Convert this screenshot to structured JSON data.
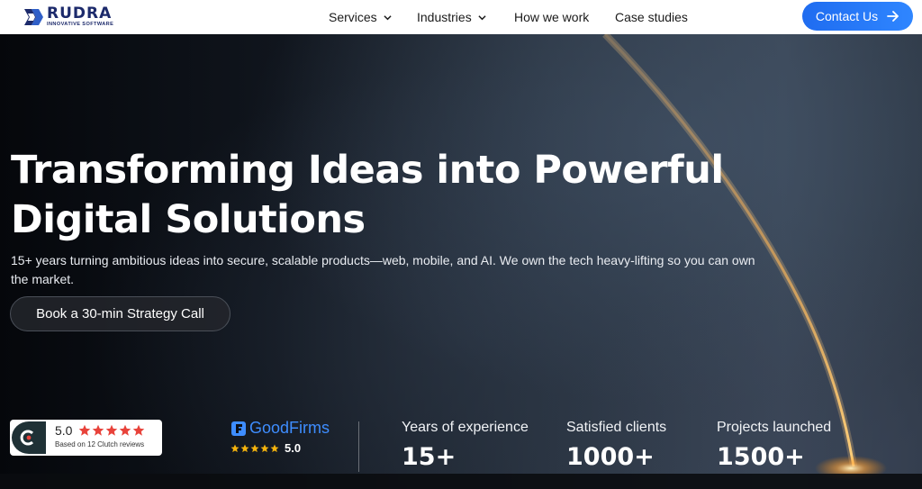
{
  "header": {
    "brand_name": "RUDRA",
    "brand_tagline": "INNOVATIVE SOFTWARE",
    "nav": [
      {
        "label": "Services",
        "has_dropdown": true
      },
      {
        "label": "Industries",
        "has_dropdown": true
      },
      {
        "label": "How we work",
        "has_dropdown": false
      },
      {
        "label": "Case studies",
        "has_dropdown": false
      }
    ],
    "contact_label": "Contact Us",
    "contact_icon": "arrow-right-icon"
  },
  "hero": {
    "headline": "Transforming Ideas into Powerful Digital Solutions",
    "subheadline": "15+ years turning ambitious ideas into secure, scalable products—web, mobile, and AI. We own the tech heavy-lifting so you can own the market.",
    "cta_label": "Book a 30-min Strategy Call"
  },
  "clutch": {
    "score": "5.0",
    "stars": 5,
    "caption": "Based on 12 Clutch reviews",
    "logo_icon": "clutch-logo-icon"
  },
  "goodfirms": {
    "brand": "GoodFirms",
    "stars": 5,
    "score": "5.0"
  },
  "stats": [
    {
      "label": "Years of experience",
      "value": "15+"
    },
    {
      "label": "Satisfied clients",
      "value": "1000+"
    },
    {
      "label": "Projects launched",
      "value": "1500+"
    }
  ],
  "colors": {
    "accent": "#2f7df6",
    "brand_navy": "#1c2a6b",
    "clutch_star": "#e8423a",
    "goodfirms_blue": "#3e8dff",
    "goodfirms_star": "#f5b40d"
  }
}
